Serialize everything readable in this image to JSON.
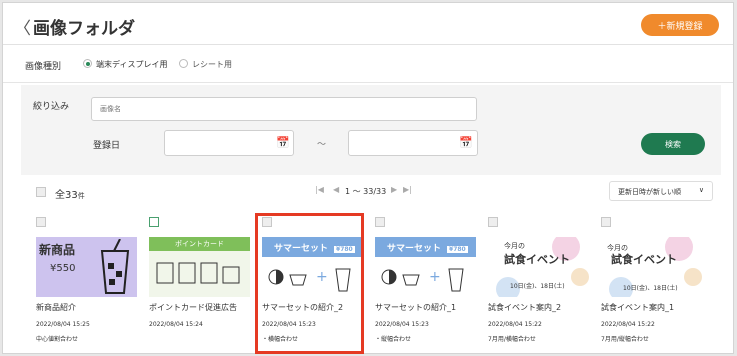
{
  "header": {
    "back": "〈",
    "title": "画像フォルダ",
    "new_button": "＋新規登録"
  },
  "image_type": {
    "label": "画像種別",
    "options": [
      {
        "label": "端末ディスプレイ用",
        "selected": true
      },
      {
        "label": "レシート用",
        "selected": false
      }
    ]
  },
  "filter": {
    "label": "絞り込み",
    "name_placeholder": "画像名",
    "date_label": "登録日",
    "range_sep": "～",
    "search_button": "検索"
  },
  "list": {
    "total_prefix": "全",
    "total": "33",
    "total_suffix": "件",
    "page_range": "1 ～ 33/33",
    "sort_label": "更新日時が新しい順",
    "sort_chevron": "∨"
  },
  "cards": [
    {
      "name": "新商品紹介",
      "date": "2022/08/04 15:25",
      "tag": "中心値割合わせ",
      "thumb_title": "新商品",
      "thumb_price": "¥550",
      "checkbox_color": "#c8c8c8"
    },
    {
      "name": "ポイントカード促進広告",
      "date": "2022/08/04 15:24",
      "tag": "",
      "thumb_title": "ポイントカード",
      "checkbox_color": "#4aa06f"
    },
    {
      "name": "サマーセットの紹介_2",
      "date": "2022/08/04 15:23",
      "tag": "・横幅合わせ",
      "thumb_title": "サマーセット",
      "thumb_price": "¥780",
      "selected": true
    },
    {
      "name": "サマーセットの紹介_1",
      "date": "2022/08/04 15:23",
      "tag": "・縦幅合わせ",
      "thumb_title": "サマーセット",
      "thumb_price": "¥780"
    },
    {
      "name": "試食イベント案内_2",
      "date": "2022/08/04 15:22",
      "tag": "7月用/横幅合わせ",
      "thumb_title": "試食イベント",
      "thumb_pre": "今月の",
      "thumb_dates": "10日(金)、18日(土)"
    },
    {
      "name": "試食イベント案内_1",
      "date": "2022/08/04 15:22",
      "tag": "7月用/縦幅合わせ",
      "thumb_title": "試食イベント",
      "thumb_pre": "今月の",
      "thumb_dates": "10日(金)、18日(土)"
    }
  ],
  "colors": {
    "accent_orange": "#f08a2c",
    "search_green": "#1f7a50",
    "selection_red": "#e53a23",
    "summer_blue": "#7ba9df",
    "newitem_purple": "#cdc3ee"
  }
}
